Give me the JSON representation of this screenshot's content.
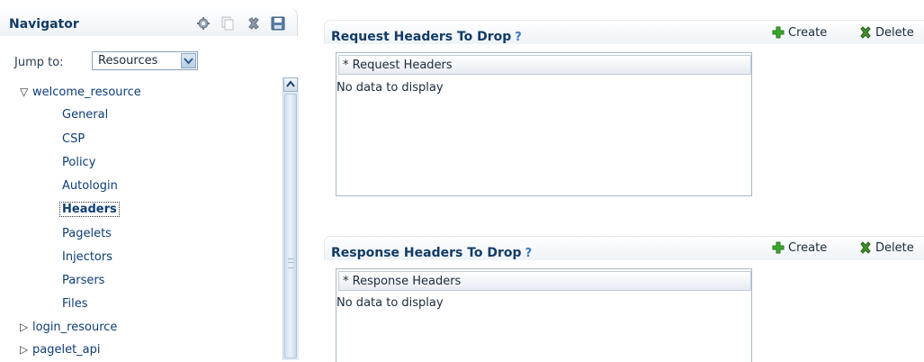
{
  "navigator": {
    "title": "Navigator",
    "jump_label": "Jump to:",
    "jump_value": "Resources",
    "tree": {
      "root_expanded": "welcome_resource",
      "children": [
        "General",
        "CSP",
        "Policy",
        "Autologin",
        "Headers",
        "Pagelets",
        "Injectors",
        "Parsers",
        "Files"
      ],
      "selected": "Headers",
      "collapsed_roots": [
        "login_resource",
        "pagelet_api"
      ]
    },
    "icons": [
      "gear-icon",
      "copy-icon",
      "delete-icon",
      "save-icon"
    ]
  },
  "request_section": {
    "title": "Request Headers To Drop",
    "help": "?",
    "create_label": "Create",
    "delete_label": "Delete",
    "column_header": "* Request Headers",
    "empty_message": "No data to display"
  },
  "response_section": {
    "title": "Response Headers To Drop",
    "help": "?",
    "create_label": "Create",
    "delete_label": "Delete",
    "column_header": "* Response Headers",
    "empty_message": "No data to display"
  },
  "colors": {
    "title": "#133b66",
    "link": "#0d3d73",
    "create_icon": "#3aa62c",
    "delete_icon": "#2f7d1f"
  }
}
